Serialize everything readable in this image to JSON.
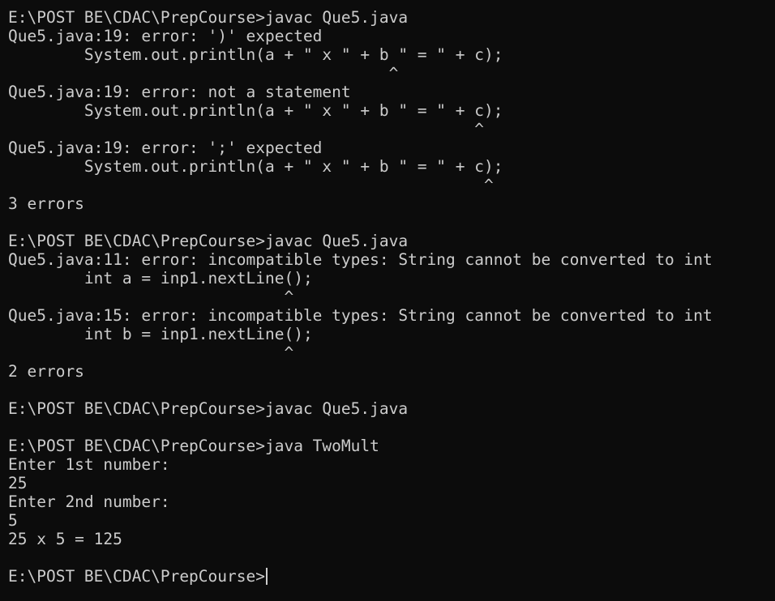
{
  "terminal": {
    "lines": [
      "E:\\POST BE\\CDAC\\PrepCourse>javac Que5.java",
      "Que5.java:19: error: ')' expected",
      "        System.out.println(a + \" x \" + b \" = \" + c);",
      "                                        ^",
      "Que5.java:19: error: not a statement",
      "        System.out.println(a + \" x \" + b \" = \" + c);",
      "                                                 ^",
      "Que5.java:19: error: ';' expected",
      "        System.out.println(a + \" x \" + b \" = \" + c);",
      "                                                  ^",
      "3 errors",
      "",
      "E:\\POST BE\\CDAC\\PrepCourse>javac Que5.java",
      "Que5.java:11: error: incompatible types: String cannot be converted to int",
      "        int a = inp1.nextLine();",
      "                             ^",
      "Que5.java:15: error: incompatible types: String cannot be converted to int",
      "        int b = inp1.nextLine();",
      "                             ^",
      "2 errors",
      "",
      "E:\\POST BE\\CDAC\\PrepCourse>javac Que5.java",
      "",
      "E:\\POST BE\\CDAC\\PrepCourse>java TwoMult",
      "Enter 1st number:",
      "25",
      "Enter 2nd number:",
      "5",
      "25 x 5 = 125",
      ""
    ],
    "current_prompt": "E:\\POST BE\\CDAC\\PrepCourse>"
  }
}
